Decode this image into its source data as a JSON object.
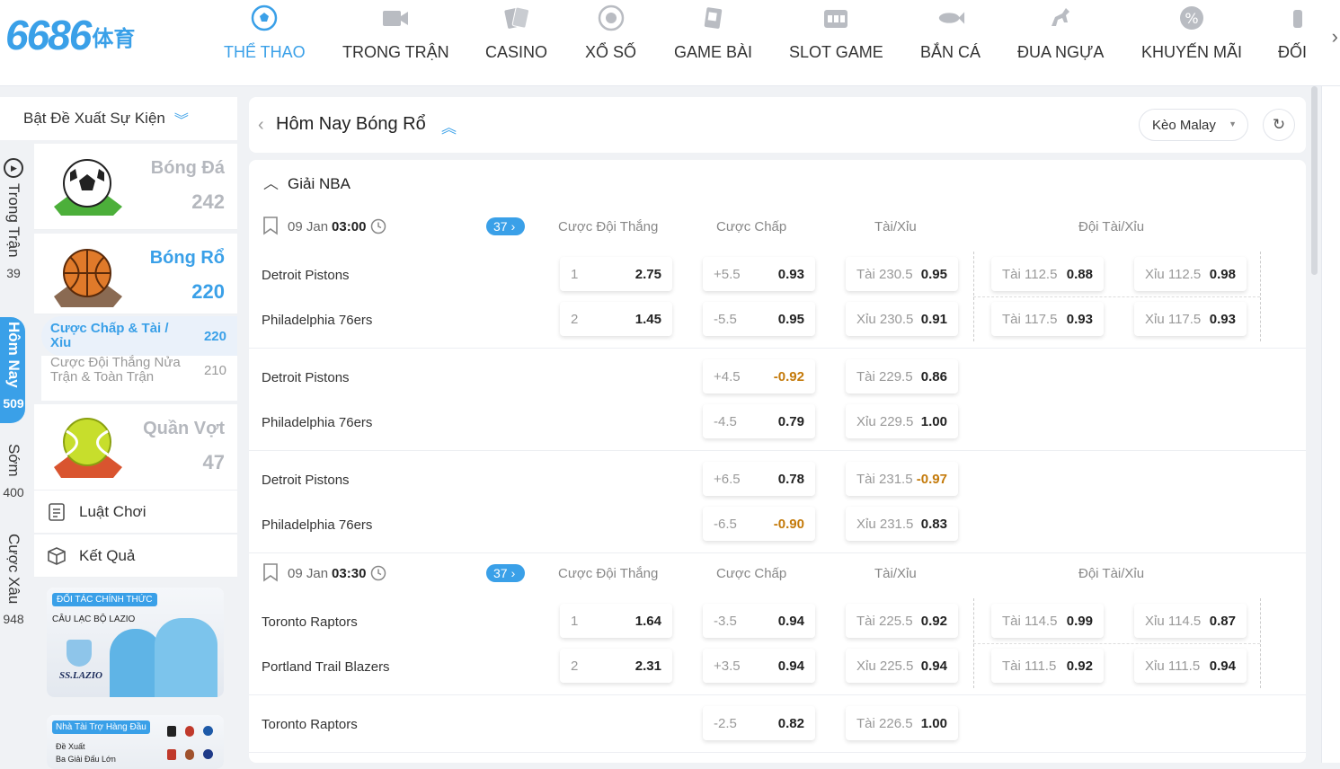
{
  "logo": {
    "number": "6686",
    "cn": "体育"
  },
  "nav": [
    {
      "label": "THỂ THAO",
      "icon": "soccer-ball-icon",
      "active": true
    },
    {
      "label": "TRONG TRẬN",
      "icon": "video-camera-icon",
      "active": false
    },
    {
      "label": "CASINO",
      "icon": "playing-cards-icon",
      "active": false
    },
    {
      "label": "XỔ SỐ",
      "icon": "lottery-ball-icon",
      "active": false
    },
    {
      "label": "GAME BÀI",
      "icon": "card-game-icon",
      "active": false
    },
    {
      "label": "SLOT GAME",
      "icon": "slot-machine-icon",
      "active": false
    },
    {
      "label": "BẮN CÁ",
      "icon": "fish-icon",
      "active": false
    },
    {
      "label": "ĐUA NGỰA",
      "icon": "horse-racing-icon",
      "active": false
    },
    {
      "label": "KHUYẾN MÃI",
      "icon": "promotion-percent-icon",
      "active": false
    },
    {
      "label": "ĐỐI",
      "icon": "partner-icon",
      "active": false
    }
  ],
  "strip": [
    {
      "label": "Trong Trận",
      "count": "39"
    },
    {
      "label": "Hôm Nay",
      "count": "509"
    },
    {
      "label": "Sớm",
      "count": "400"
    },
    {
      "label": "Cược Xâu",
      "count": "948"
    }
  ],
  "sidebar": {
    "header": "Bật Đề Xuất Sự Kiện",
    "sports": [
      {
        "name": "Bóng Đá",
        "count": "242"
      },
      {
        "name": "Bóng Rổ",
        "count": "220"
      },
      {
        "name": "Quần Vợt",
        "count": "47"
      }
    ],
    "sub": [
      {
        "label": "Cược Chấp & Tài / Xỉu",
        "count": "220"
      },
      {
        "label": "Cược Đội Thắng Nửa Trận & Toàn Trận",
        "count": "210"
      }
    ],
    "links": [
      "Luật Chơi",
      "Kết Quả"
    ],
    "banner1": {
      "tag": "ĐỐI TÁC CHÍNH THỨC",
      "text": "CÂU LẠC BỘ LAZIO",
      "club": "SS.LAZIO"
    },
    "banner2": {
      "tag": "Nhà Tài Trợ Hàng Đầu",
      "line1": "Đề Xuất",
      "line2": "Ba Giải Đấu Lớn"
    }
  },
  "main": {
    "title": "Hôm Nay Bóng Rổ",
    "odds_type": "Kèo Malay",
    "league": "Giải NBA",
    "columns": [
      "Cược Đội Thắng",
      "Cược Chấp",
      "Tài/Xỉu",
      "Đội Tài/Xỉu"
    ],
    "matches": [
      {
        "date": "09 Jan",
        "time": "03:00",
        "markets": "37",
        "lines": [
          {
            "teams": [
              "Detroit Pistons",
              "Philadelphia 76ers"
            ],
            "ml": [
              {
                "k": "1",
                "v": "2.75"
              },
              {
                "k": "2",
                "v": "1.45"
              }
            ],
            "hdp": [
              {
                "k": "+5.5",
                "v": "0.93"
              },
              {
                "k": "-5.5",
                "v": "0.95"
              }
            ],
            "ou": [
              {
                "k": "Tài 230.5",
                "v": "0.95"
              },
              {
                "k": "Xỉu 230.5",
                "v": "0.91"
              }
            ],
            "tou": [
              [
                {
                  "k": "Tài 112.5",
                  "v": "0.88"
                },
                {
                  "k": "Xỉu 112.5",
                  "v": "0.98"
                }
              ],
              [
                {
                  "k": "Tài 117.5",
                  "v": "0.93"
                },
                {
                  "k": "Xỉu 117.5",
                  "v": "0.93"
                }
              ]
            ]
          },
          {
            "teams": [
              "Detroit Pistons",
              "Philadelphia 76ers"
            ],
            "hdp": [
              {
                "k": "+4.5",
                "v": "-0.92"
              },
              {
                "k": "-4.5",
                "v": "0.79"
              }
            ],
            "ou": [
              {
                "k": "Tài 229.5",
                "v": "0.86"
              },
              {
                "k": "Xỉu 229.5",
                "v": "1.00"
              }
            ]
          },
          {
            "teams": [
              "Detroit Pistons",
              "Philadelphia 76ers"
            ],
            "hdp": [
              {
                "k": "+6.5",
                "v": "0.78"
              },
              {
                "k": "-6.5",
                "v": "-0.90"
              }
            ],
            "ou": [
              {
                "k": "Tài 231.5",
                "v": "-0.97"
              },
              {
                "k": "Xỉu 231.5",
                "v": "0.83"
              }
            ]
          }
        ]
      },
      {
        "date": "09 Jan",
        "time": "03:30",
        "markets": "37",
        "lines": [
          {
            "teams": [
              "Toronto Raptors",
              "Portland Trail Blazers"
            ],
            "ml": [
              {
                "k": "1",
                "v": "1.64"
              },
              {
                "k": "2",
                "v": "2.31"
              }
            ],
            "hdp": [
              {
                "k": "-3.5",
                "v": "0.94"
              },
              {
                "k": "+3.5",
                "v": "0.94"
              }
            ],
            "ou": [
              {
                "k": "Tài 225.5",
                "v": "0.92"
              },
              {
                "k": "Xỉu 225.5",
                "v": "0.94"
              }
            ],
            "tou": [
              [
                {
                  "k": "Tài 114.5",
                  "v": "0.99"
                },
                {
                  "k": "Xỉu 114.5",
                  "v": "0.87"
                }
              ],
              [
                {
                  "k": "Tài 111.5",
                  "v": "0.92"
                },
                {
                  "k": "Xỉu 111.5",
                  "v": "0.94"
                }
              ]
            ]
          },
          {
            "teams": [
              "Toronto Raptors"
            ],
            "hdp": [
              {
                "k": "-2.5",
                "v": "0.82"
              }
            ],
            "ou": [
              {
                "k": "Tài 226.5",
                "v": "1.00"
              }
            ]
          }
        ]
      }
    ]
  },
  "colors": {
    "accent": "#3aa0e8",
    "negative": "#c47a0a"
  }
}
